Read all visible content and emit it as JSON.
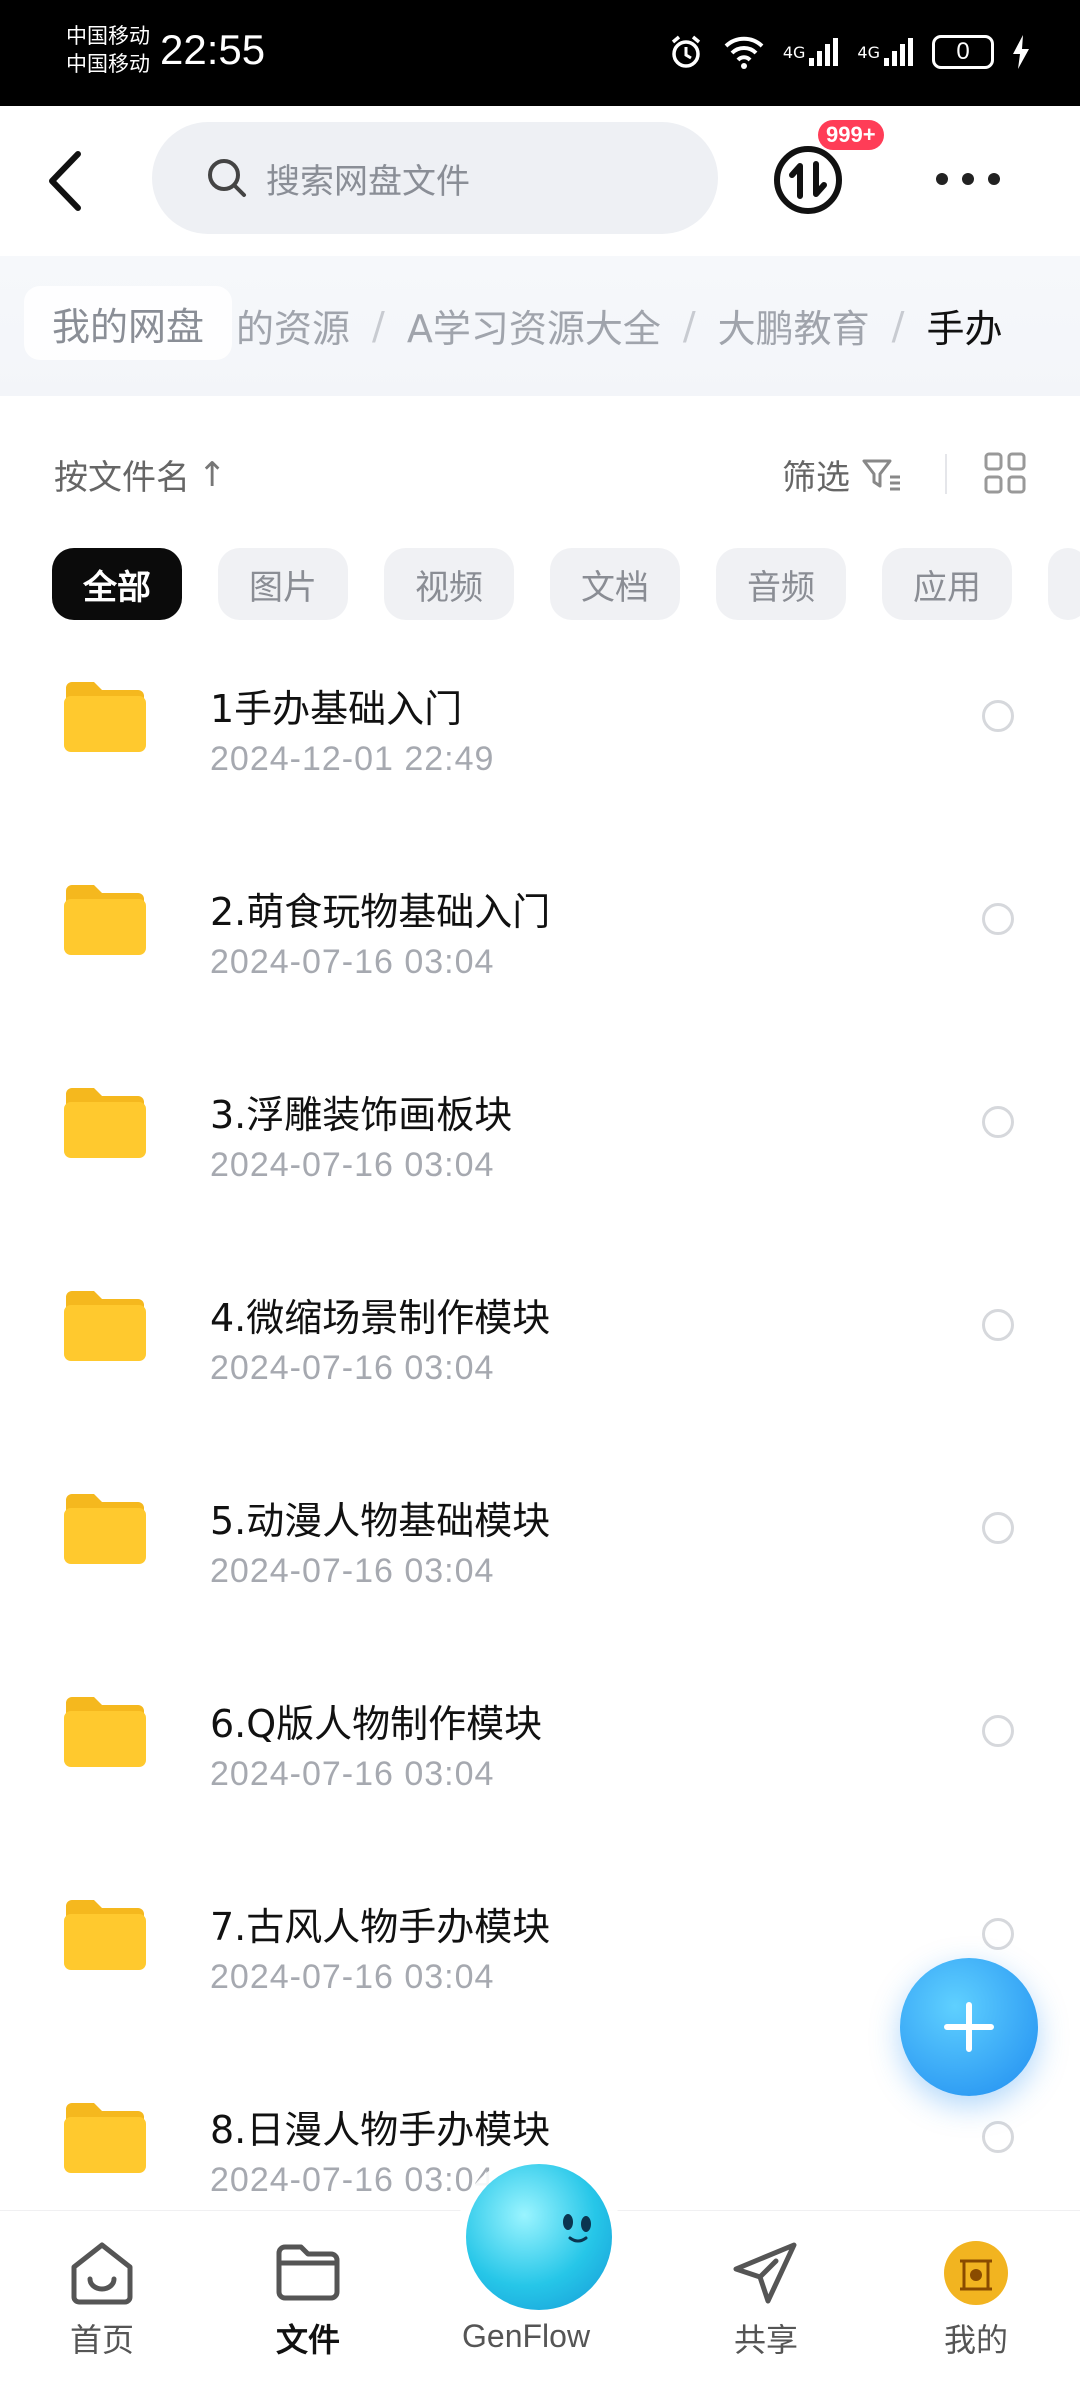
{
  "status_bar": {
    "carrier_1": "中国移动",
    "carrier_2": "中国移动",
    "time": "22:55",
    "net_1": "4G",
    "net_2": "4G",
    "battery": "0"
  },
  "header": {
    "search_placeholder": "搜索网盘文件",
    "transfer_badge": "999+"
  },
  "breadcrumb": {
    "root": "我的网盘",
    "items": [
      "的资源",
      "A学习资源大全",
      "大鹏教育",
      "手办"
    ],
    "separator": "/"
  },
  "toolbar": {
    "sort_label": "按文件名",
    "sort_arrow": "↑",
    "filter_label": "筛选"
  },
  "chips": [
    "全部",
    "图片",
    "视频",
    "文档",
    "音频",
    "应用"
  ],
  "files": [
    {
      "name": "1手办基础入门",
      "date": "2024-12-01  22:49"
    },
    {
      "name": "2.萌食玩物基础入门",
      "date": "2024-07-16  03:04"
    },
    {
      "name": "3.浮雕装饰画板块",
      "date": "2024-07-16  03:04"
    },
    {
      "name": "4.微缩场景制作模块",
      "date": "2024-07-16  03:04"
    },
    {
      "name": "5.动漫人物基础模块",
      "date": "2024-07-16  03:04"
    },
    {
      "name": "6.Q版人物制作模块",
      "date": "2024-07-16  03:04"
    },
    {
      "name": "7.古风人物手办模块",
      "date": "2024-07-16  03:04"
    },
    {
      "name": "8.日漫人物手办模块",
      "date": "2024-07-16  03:04"
    }
  ],
  "nav": {
    "home": "首页",
    "files": "文件",
    "genflow": "GenFlow",
    "share": "共享",
    "mine": "我的"
  },
  "colors": {
    "folder": "#FFC92E",
    "accent": "#1F8CF0",
    "badge": "#FF3D57"
  }
}
